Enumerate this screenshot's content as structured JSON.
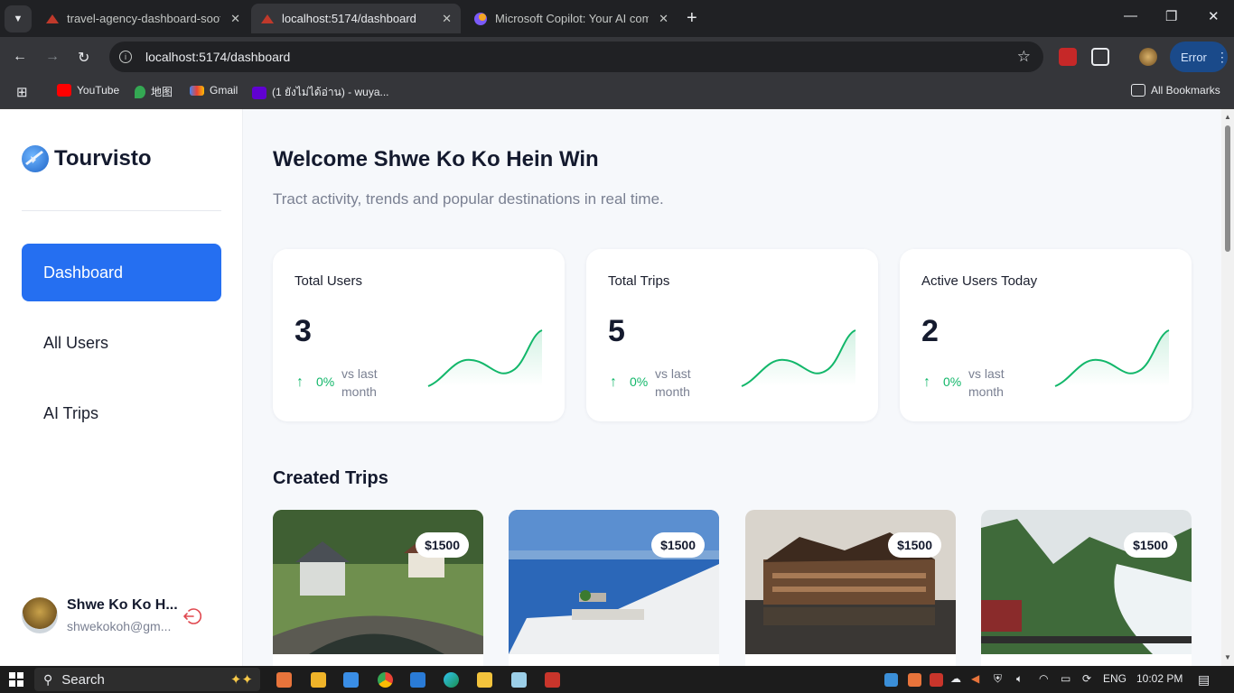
{
  "browser": {
    "tabs": [
      {
        "title": "travel-agency-dashboard-sooty",
        "active": false
      },
      {
        "title": "localhost:5174/dashboard",
        "active": true
      },
      {
        "title": "Microsoft Copilot: Your AI comp",
        "active": false
      }
    ],
    "url": "localhost:5174/dashboard",
    "error_label": "Error",
    "bookmarks": [
      {
        "label": "YouTube"
      },
      {
        "label": "地图"
      },
      {
        "label": "Gmail"
      },
      {
        "label": "(1 ยังไม่ได้อ่าน) - wuya..."
      }
    ],
    "all_bookmarks": "All Bookmarks"
  },
  "sidebar": {
    "brand": "Tourvisto",
    "items": [
      {
        "label": "Dashboard",
        "active": true
      },
      {
        "label": "All Users",
        "active": false
      },
      {
        "label": "AI Trips",
        "active": false
      }
    ],
    "user": {
      "name": "Shwe Ko Ko H...",
      "email": "shwekokoh@gm..."
    }
  },
  "header": {
    "title": "Welcome Shwe Ko Ko Hein Win",
    "subtitle": "Tract activity, trends and popular destinations in real time."
  },
  "stats": [
    {
      "label": "Total Users",
      "value": "3",
      "change": "0%",
      "compare": "vs last month"
    },
    {
      "label": "Total Trips",
      "value": "5",
      "change": "0%",
      "compare": "vs last month"
    },
    {
      "label": "Active Users Today",
      "value": "2",
      "change": "0%",
      "compare": "vs last month"
    }
  ],
  "created_trips": {
    "title": "Created Trips",
    "trips": [
      {
        "price": "$1500"
      },
      {
        "price": "$1500"
      },
      {
        "price": "$1500"
      },
      {
        "price": "$1500"
      }
    ]
  },
  "taskbar": {
    "search_label": "Search",
    "language": "ENG",
    "time": "10:02 PM"
  },
  "colors": {
    "accent": "#256ff1",
    "positive": "#12b76a",
    "page_bg": "#f6f8fb"
  }
}
